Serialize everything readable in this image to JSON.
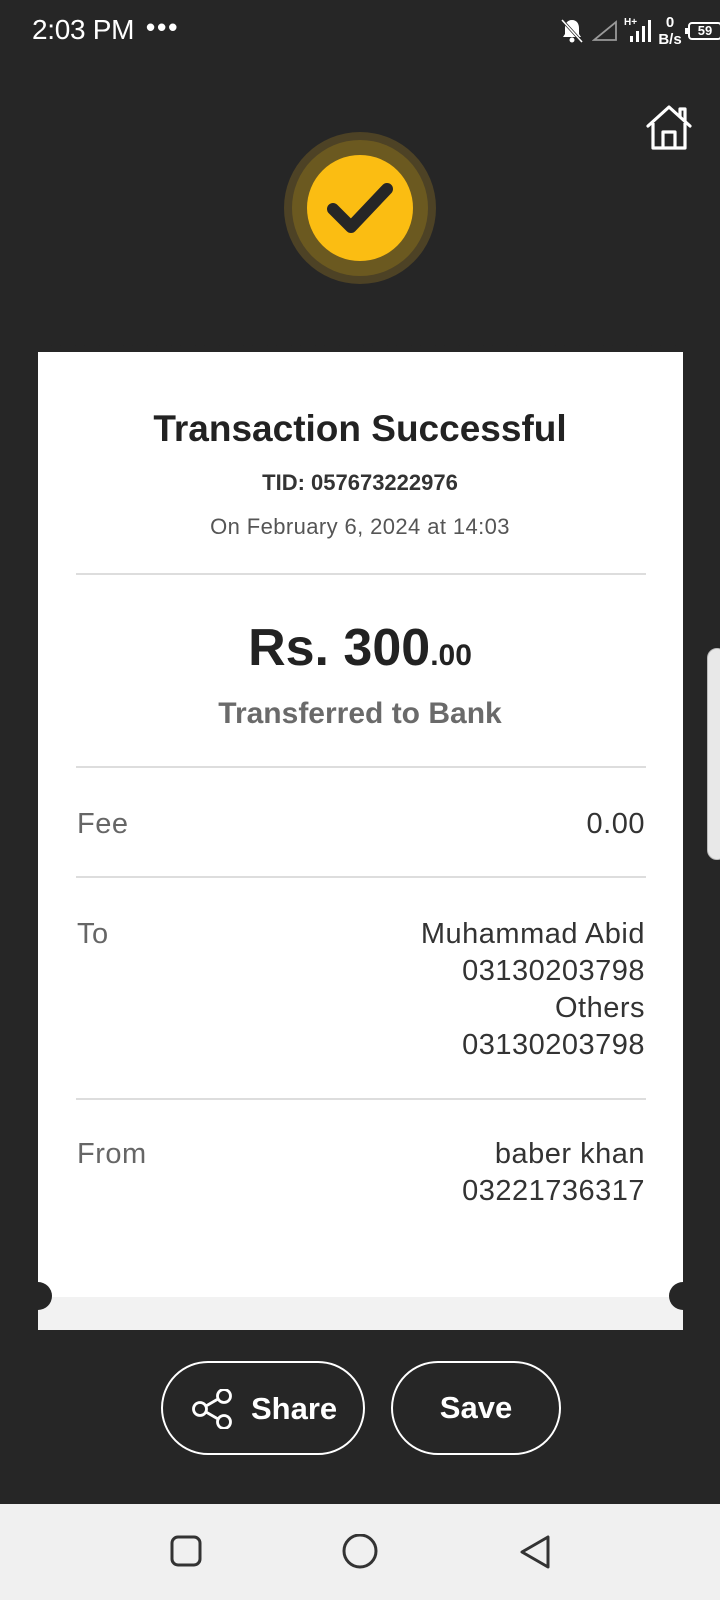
{
  "status_bar": {
    "time": "2:03 PM",
    "dots": "•••",
    "network_speed_value": "0",
    "network_speed_unit": "B/s",
    "battery": "59",
    "icons": [
      "notifications-muted-icon",
      "signal-empty-icon",
      "hplus-signal-icon",
      "battery-icon"
    ]
  },
  "header": {
    "home_icon": "home-icon",
    "status_icon": "checkmark-icon",
    "accent_color": "#fbbd12"
  },
  "receipt": {
    "title": "Transaction Successful",
    "tid": "TID: 057673222976",
    "date": "On February 6, 2024 at 14:03",
    "amount_main": "Rs. 300",
    "amount_cents": ".00",
    "subtitle": "Transferred to Bank",
    "fee": {
      "label": "Fee",
      "value": "0.00"
    },
    "to": {
      "label": "To",
      "lines": [
        "Muhammad Abid",
        "03130203798",
        "Others",
        "03130203798"
      ]
    },
    "from": {
      "label": "From",
      "lines": [
        "baber khan",
        "03221736317"
      ]
    }
  },
  "actions": {
    "share_label": "Share",
    "save_label": "Save"
  },
  "nav_bar": {
    "icons": [
      "recents-square-icon",
      "home-circle-icon",
      "back-triangle-icon"
    ]
  }
}
